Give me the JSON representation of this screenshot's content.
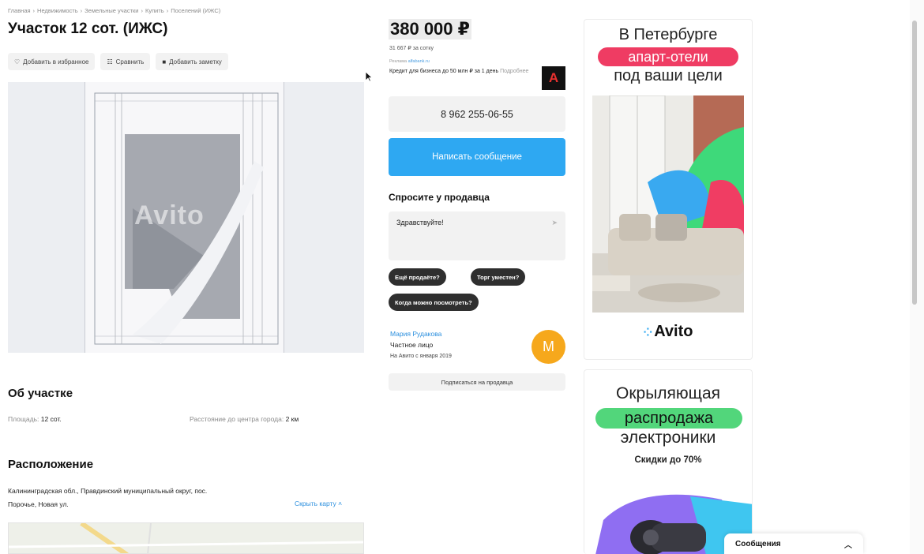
{
  "breadcrumb": [
    "Главная",
    "Недвижимость",
    "Земельные участки",
    "Купить",
    "Поселений (ИЖС)"
  ],
  "listing": {
    "title": "Участок 12 сот. (ИЖС)",
    "actions": {
      "favorite": "Добавить в избранное",
      "compare": "Сравнить",
      "note": "Добавить заметку"
    },
    "photo_watermark": "Avito"
  },
  "about": {
    "heading": "Об участке",
    "area_label": "Площадь:",
    "area_value": "12 сот.",
    "distance_label": "Расстояние до центра города:",
    "distance_value": "2 км"
  },
  "location": {
    "heading": "Расположение",
    "address_line1": "Калининградская обл., Правдинский муниципальный округ, пос.",
    "address_line2": "Порочье, Новая ул.",
    "toggle_map": "Скрыть карту ˄"
  },
  "sidebar": {
    "price": "380 000 ₽",
    "price_per_area": "31 667 ₽ за сотку",
    "ad_label": "Реклама",
    "ad_domain": "alfabank.ru",
    "credit_text": "Кредит для бизнеса до 50 млн ₽ за 1 день",
    "credit_more": "Подробнее",
    "bank_logo_letter": "А",
    "phone": "8 962 255-06-55",
    "write_message": "Написать сообщение",
    "ask_heading": "Спросите у продавца",
    "ask_input_value": "Здравствуйте!",
    "quick_questions": [
      "Ещё продаёте?",
      "Торг уместен?",
      "Когда можно посмотреть?"
    ],
    "seller": {
      "name": "Мария Рудакова",
      "type": "Частное лицо",
      "since": "На Авито с января 2019",
      "avatar_letter": "М"
    },
    "subscribe": "Подписаться на продавца"
  },
  "ads": {
    "ad1": {
      "line1": "В Петербурге",
      "highlight": "апарт-отели",
      "line3": "под ваши цели",
      "logo": "Avito"
    },
    "ad2": {
      "line1": "Окрыляющая",
      "highlight": "распродажа",
      "line3": "электроники",
      "line4": "Скидки до 70%"
    }
  },
  "messages_bar": {
    "label": "Сообщения"
  },
  "colors": {
    "accent_blue": "#2ea8f2",
    "link_blue": "#2b8fde",
    "ad_pink": "#ef3c63",
    "ad_green": "#52d67b",
    "avatar_orange": "#f6a81c"
  }
}
